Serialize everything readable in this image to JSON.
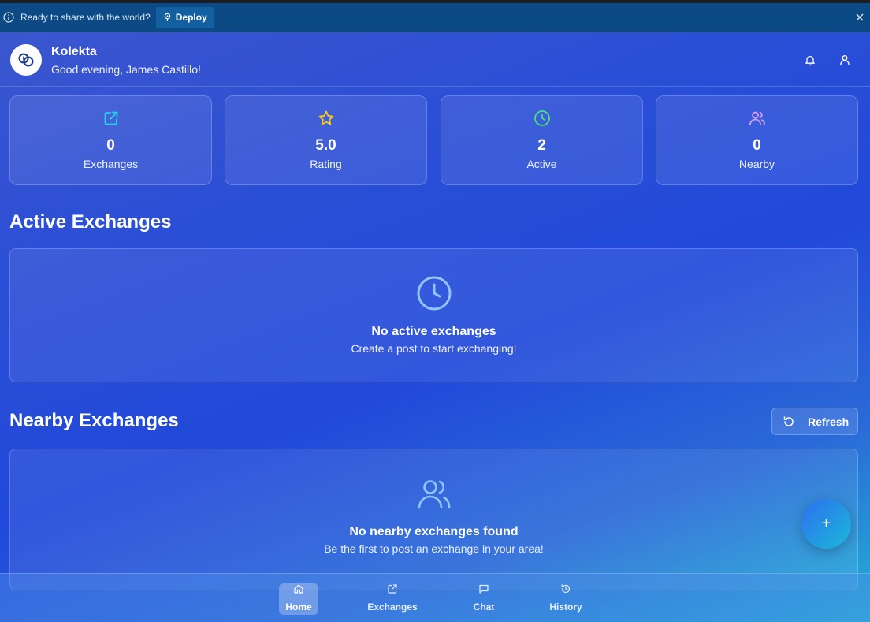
{
  "deploy_bar": {
    "message": "Ready to share with the world?",
    "deploy_label": "Deploy"
  },
  "header": {
    "app_name": "Kolekta",
    "greeting": "Good evening, James Castillo!"
  },
  "stats": [
    {
      "value": "0",
      "label": "Exchanges",
      "icon": "external-link-icon",
      "color": "#22d3ee"
    },
    {
      "value": "5.0",
      "label": "Rating",
      "icon": "star-icon",
      "color": "#facc15"
    },
    {
      "value": "2",
      "label": "Active",
      "icon": "clock-icon",
      "color": "#4ade80"
    },
    {
      "value": "0",
      "label": "Nearby",
      "icon": "users-icon",
      "color": "#d8a4f5"
    }
  ],
  "active_section": {
    "title": "Active Exchanges",
    "empty_title": "No active exchanges",
    "empty_subtitle": "Create a post to start exchanging!"
  },
  "nearby_section": {
    "title": "Nearby Exchanges",
    "refresh_label": "Refresh",
    "empty_title": "No nearby exchanges found",
    "empty_subtitle": "Be the first to post an exchange in your area!"
  },
  "fab": {
    "label": "+"
  },
  "nav": [
    {
      "label": "Home",
      "icon": "home-icon",
      "active": true
    },
    {
      "label": "Exchanges",
      "icon": "external-link-icon",
      "active": false
    },
    {
      "label": "Chat",
      "icon": "chat-icon",
      "active": false
    },
    {
      "label": "History",
      "icon": "history-icon",
      "active": false
    }
  ]
}
